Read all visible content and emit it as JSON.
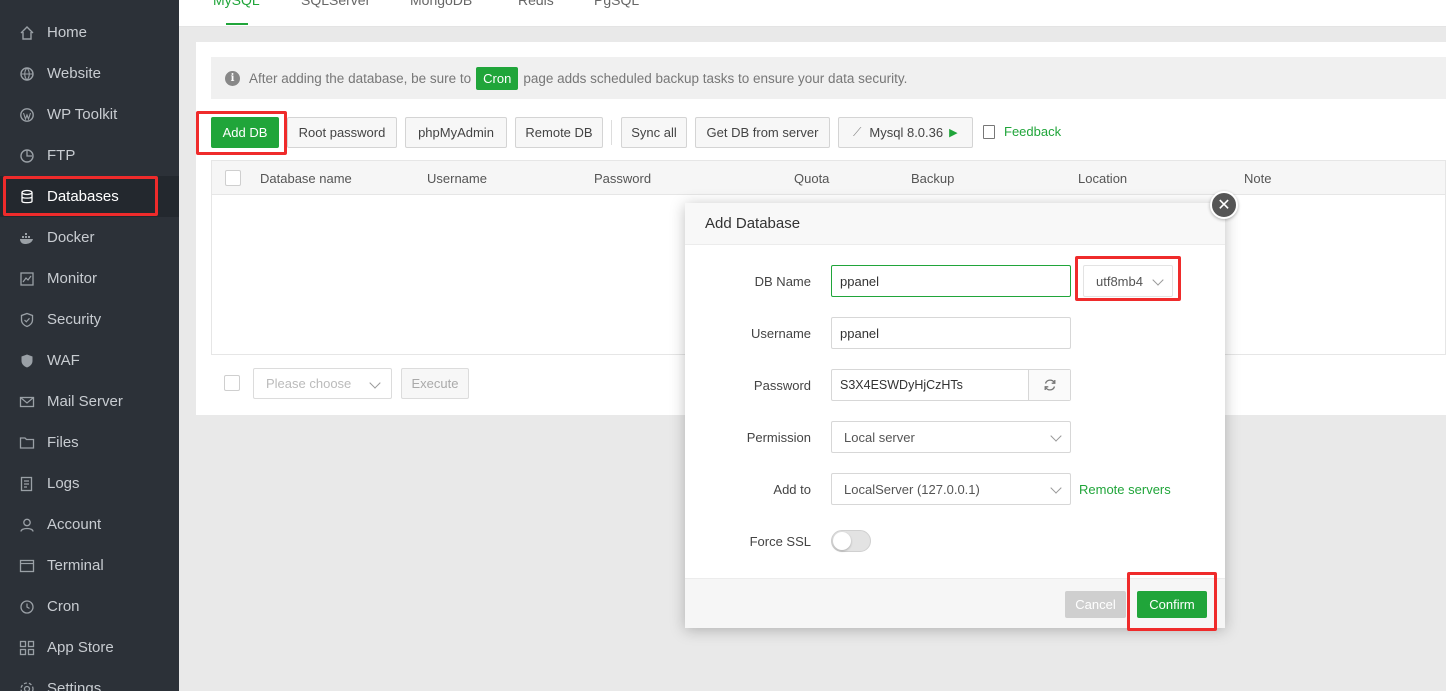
{
  "sidebar": {
    "items": [
      {
        "label": "Home",
        "icon": "home-icon"
      },
      {
        "label": "Website",
        "icon": "globe-icon"
      },
      {
        "label": "WP Toolkit",
        "icon": "wordpress-icon"
      },
      {
        "label": "FTP",
        "icon": "ftp-icon"
      },
      {
        "label": "Databases",
        "icon": "database-icon",
        "active": true
      },
      {
        "label": "Docker",
        "icon": "docker-icon"
      },
      {
        "label": "Monitor",
        "icon": "monitor-icon"
      },
      {
        "label": "Security",
        "icon": "shield-icon"
      },
      {
        "label": "WAF",
        "icon": "waf-icon"
      },
      {
        "label": "Mail Server",
        "icon": "mail-icon"
      },
      {
        "label": "Files",
        "icon": "folder-icon"
      },
      {
        "label": "Logs",
        "icon": "logs-icon"
      },
      {
        "label": "Account",
        "icon": "user-icon"
      },
      {
        "label": "Terminal",
        "icon": "terminal-icon"
      },
      {
        "label": "Cron",
        "icon": "clock-icon"
      },
      {
        "label": "App Store",
        "icon": "app-store-icon"
      },
      {
        "label": "Settings",
        "icon": "gear-icon"
      }
    ]
  },
  "tabs": [
    "MySQL",
    "SQLServer",
    "MongoDB",
    "Redis",
    "PgSQL"
  ],
  "alert": {
    "text_before": "After adding the database, be sure to",
    "badge": "Cron",
    "text_after": "page adds scheduled backup tasks to ensure your data security."
  },
  "toolbar": {
    "add_db": "Add DB",
    "root_password": "Root password",
    "phpmyadmin": "phpMyAdmin",
    "remote_db": "Remote DB",
    "sync_all": "Sync all",
    "get_db": "Get DB from server",
    "mysql_version": "Mysql 8.0.36",
    "feedback": "Feedback"
  },
  "table": {
    "columns": [
      "Database name",
      "Username",
      "Password",
      "Quota",
      "Backup",
      "Location",
      "Note"
    ]
  },
  "bulk": {
    "placeholder": "Please choose",
    "execute": "Execute"
  },
  "modal": {
    "title": "Add Database",
    "fields": {
      "db_name_label": "DB Name",
      "db_name_value": "ppanel",
      "charset": "utf8mb4",
      "username_label": "Username",
      "username_value": "ppanel",
      "password_label": "Password",
      "password_value": "S3X4ESWDyHjCzHTs",
      "permission_label": "Permission",
      "permission_value": "Local server",
      "add_to_label": "Add to",
      "add_to_value": "LocalServer (127.0.0.1)",
      "remote_servers": "Remote servers",
      "force_ssl_label": "Force SSL",
      "force_ssl": false
    },
    "cancel": "Cancel",
    "confirm": "Confirm"
  },
  "colors": {
    "accent": "#20a53a",
    "highlight": "#ef2b2b",
    "sidebar": "#2c3138"
  }
}
